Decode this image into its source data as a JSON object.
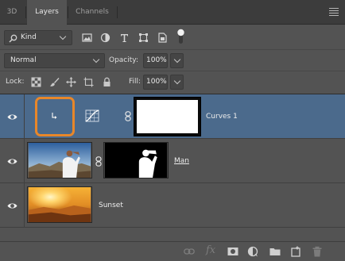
{
  "tabs": [
    {
      "label": "3D"
    },
    {
      "label": "Layers"
    },
    {
      "label": "Channels"
    }
  ],
  "filter": {
    "kind_label": "Kind",
    "icons": [
      "pixel-filter-icon",
      "adjustment-filter-icon",
      "type-filter-icon",
      "shape-filter-icon",
      "smart-object-filter-icon",
      "filter-toggle-icon"
    ]
  },
  "blend": {
    "mode": "Normal",
    "opacity_label": "Opacity:",
    "opacity_value": "100%"
  },
  "lock": {
    "label": "Lock:",
    "fill_label": "Fill:",
    "fill_value": "100%",
    "icons": [
      "lock-transparent-pixels-icon",
      "lock-image-pixels-icon",
      "lock-position-icon",
      "prevent-autonest-icon",
      "lock-all-icon"
    ]
  },
  "layers": [
    {
      "name": "Curves 1",
      "type": "adjustment",
      "selected": true,
      "visible": true
    },
    {
      "name": "Man",
      "type": "pixel-with-mask",
      "selected": false,
      "visible": true
    },
    {
      "name": "Sunset",
      "type": "pixel",
      "selected": false,
      "visible": true
    }
  ],
  "bottom_bar": {
    "icons": [
      "link-layers-icon",
      "fx-icon",
      "add-mask-icon",
      "new-adjustment-icon",
      "new-group-icon",
      "new-layer-icon",
      "delete-icon"
    ],
    "fx_label": "fx"
  },
  "colors": {
    "panel_bg": "#535353",
    "selected_row": "#4b6a8c",
    "highlight_ring": "#e8872a"
  }
}
